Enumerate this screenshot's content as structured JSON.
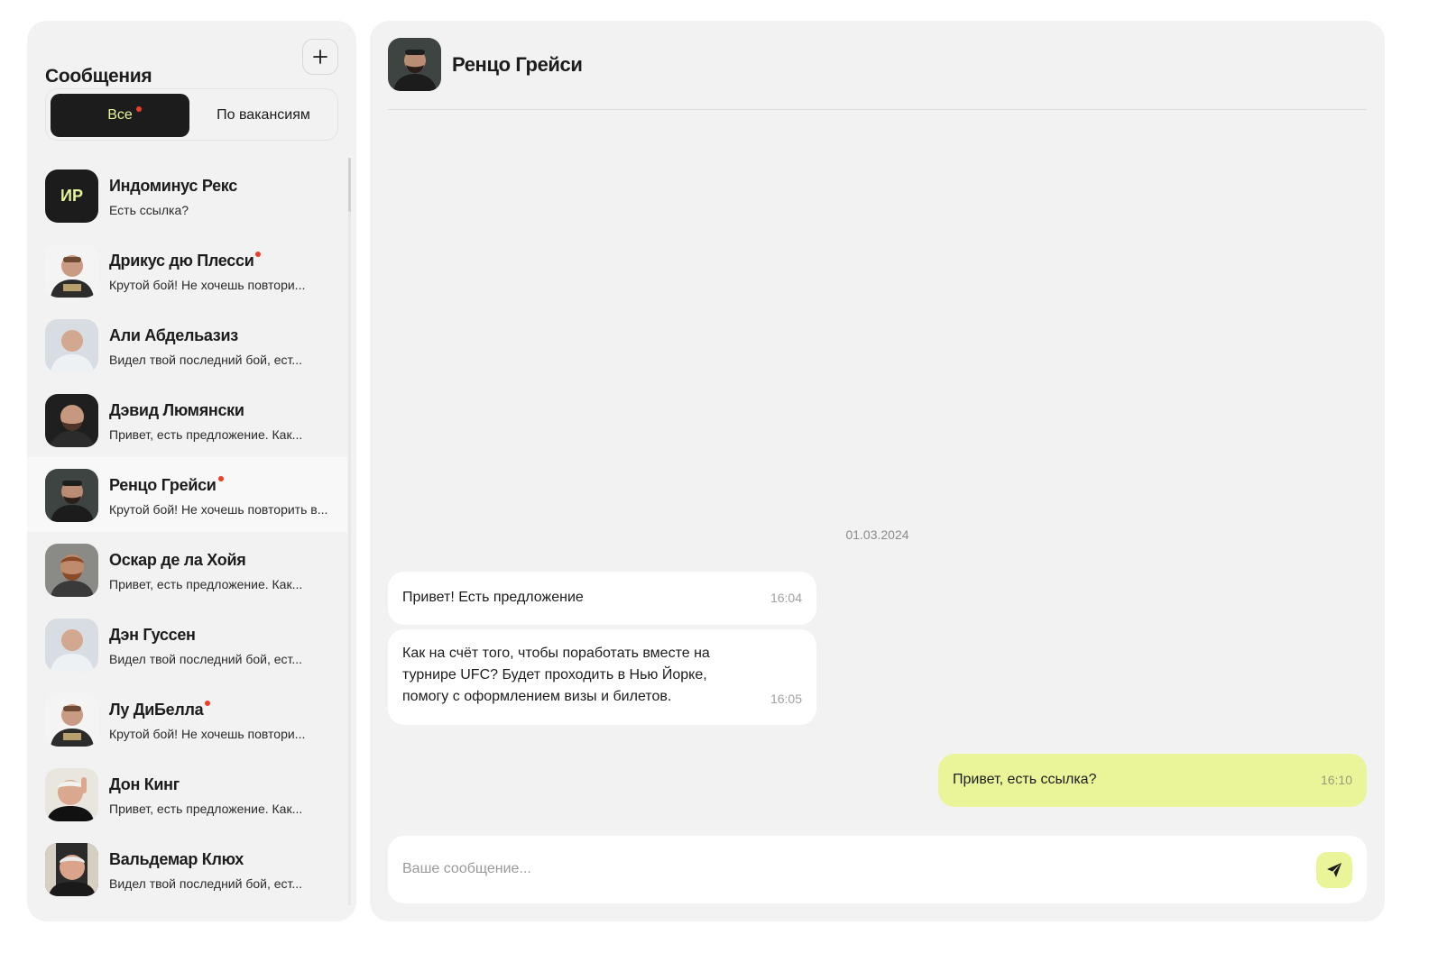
{
  "sidebar": {
    "title": "Сообщения",
    "add_icon": "plus-icon",
    "filters": [
      {
        "label": "Все",
        "active": true,
        "has_unread": true
      },
      {
        "label": "По вакансиям",
        "active": false,
        "has_unread": false
      }
    ],
    "chats": [
      {
        "name": "Индоминус Рекс",
        "preview": "Есть ссылка?",
        "avatar": "initials",
        "initials": "ИР",
        "unread": false,
        "selected": false
      },
      {
        "name": "Дрикус дю Плесси",
        "preview": "Крутой бой! Не хочешь повтори...",
        "avatar": "photo",
        "unread": true,
        "selected": false
      },
      {
        "name": "Али Абдельазиз",
        "preview": "Видел твой последний бой, ест...",
        "avatar": "photo",
        "unread": false,
        "selected": false
      },
      {
        "name": "Дэвид Люмянски",
        "preview": "Привет, есть предложение. Как...",
        "avatar": "photo",
        "unread": false,
        "selected": false
      },
      {
        "name": "Ренцо Грейси",
        "preview": "Крутой бой! Не хочешь повторить в...",
        "avatar": "photo",
        "unread": true,
        "selected": true
      },
      {
        "name": "Оскар де ла Хойя",
        "preview": "Привет, есть предложение. Как...",
        "avatar": "photo",
        "unread": false,
        "selected": false
      },
      {
        "name": "Дэн Гуссен",
        "preview": "Видел твой последний бой, ест...",
        "avatar": "photo",
        "unread": false,
        "selected": false
      },
      {
        "name": "Лу ДиБелла",
        "preview": "Крутой бой! Не хочешь повтори...",
        "avatar": "photo",
        "unread": true,
        "selected": false
      },
      {
        "name": "Дон Кинг",
        "preview": "Привет, есть предложение. Как...",
        "avatar": "photo",
        "unread": false,
        "selected": false
      },
      {
        "name": "Вальдемар Клюх",
        "preview": "Видел твой последний бой, ест...",
        "avatar": "photo",
        "unread": false,
        "selected": false
      }
    ]
  },
  "chat": {
    "contact_name": "Ренцо Грейси",
    "date": "01.03.2024",
    "messages": [
      {
        "direction": "incoming",
        "text": "Привет! Есть предложение",
        "time": "16:04"
      },
      {
        "direction": "incoming",
        "text": "Как на счёт того, чтобы поработать вместе на турнире UFC? Будет проходить в Нью Йорке, помогу с оформлением визы и билетов.",
        "time": "16:05"
      },
      {
        "direction": "outgoing",
        "text": "Привет, есть ссылка?",
        "time": "16:10"
      }
    ],
    "composer": {
      "placeholder": "Ваше сообщение...",
      "value": "",
      "send_icon": "send-icon"
    }
  },
  "colors": {
    "panel": "#f2f2f2",
    "dark": "#1c1c1c",
    "accent": "#eaf59a",
    "unread_dot": "#f03d26"
  }
}
